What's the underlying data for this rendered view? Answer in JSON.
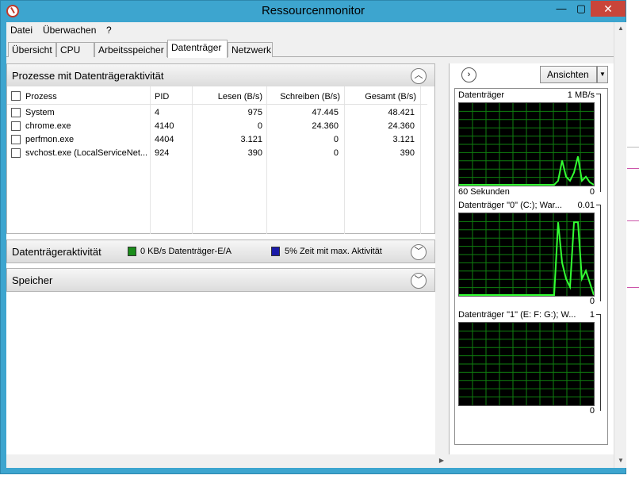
{
  "window": {
    "title": "Ressourcenmonitor",
    "minimize": "—",
    "maximize": "▢",
    "close": "✕"
  },
  "menu": [
    "Datei",
    "Überwachen",
    "?"
  ],
  "tabs": [
    "Übersicht",
    "CPU",
    "Arbeitsspeicher",
    "Datenträger",
    "Netzwerk"
  ],
  "active_tab": "Datenträger",
  "processes": {
    "title": "Prozesse mit Datenträgeraktivität",
    "columns": [
      "Prozess",
      "PID",
      "Lesen (B/s)",
      "Schreiben (B/s)",
      "Gesamt (B/s)"
    ],
    "rows": [
      {
        "name": "System",
        "pid": "4",
        "read": "975",
        "write": "47.445",
        "total": "48.421"
      },
      {
        "name": "chrome.exe",
        "pid": "4140",
        "read": "0",
        "write": "24.360",
        "total": "24.360"
      },
      {
        "name": "perfmon.exe",
        "pid": "4404",
        "read": "3.121",
        "write": "0",
        "total": "3.121"
      },
      {
        "name": "svchost.exe (LocalServiceNet...",
        "pid": "924",
        "read": "390",
        "write": "0",
        "total": "390"
      }
    ]
  },
  "disk_activity": {
    "title": "Datenträgeraktivität",
    "io_text": "0 KB/s Datenträger-E/A",
    "time_text": "5% Zeit mit max. Aktivität",
    "io_color": "#1a8c1a",
    "time_color": "#1a1aa8"
  },
  "storage": {
    "title": "Speicher"
  },
  "side": {
    "views_label": "Ansichten",
    "graphs": [
      {
        "title": "Datenträger",
        "max": "1 MB/s",
        "bottom_left": "60 Sekunden",
        "bottom_right": "0",
        "line_color": "#33ff33",
        "spikes": [
          0,
          0,
          0,
          0,
          0,
          0,
          0,
          0,
          0,
          0,
          0,
          0,
          0,
          0,
          0,
          0,
          0,
          0,
          0,
          0,
          0,
          0,
          0,
          0,
          0,
          0.05,
          0.3,
          0.1,
          0.05,
          0.15,
          0.35,
          0.05,
          0.1,
          0.03,
          0.0
        ]
      },
      {
        "title": "Datenträger \"0\" (C:); War...",
        "max": "0.01",
        "bottom_left": "",
        "bottom_right": "0",
        "line_color": "#33ff33",
        "spikes": [
          0,
          0,
          0,
          0,
          0,
          0,
          0,
          0,
          0,
          0,
          0,
          0,
          0,
          0,
          0,
          0,
          0,
          0,
          0,
          0,
          0,
          0,
          0,
          0,
          0,
          0.9,
          0.4,
          0.2,
          0.1,
          0.9,
          0.9,
          0.2,
          0.3,
          0.15,
          0.0
        ]
      },
      {
        "title": "Datenträger \"1\" (E: F: G:); W...",
        "max": "1",
        "bottom_left": "",
        "bottom_right": "0",
        "line_color": "#33ff33",
        "spikes": []
      }
    ]
  },
  "colors": {
    "title_bar": "#3da5cf",
    "close_button": "#c9453a",
    "grid": "#0f7f0f"
  }
}
